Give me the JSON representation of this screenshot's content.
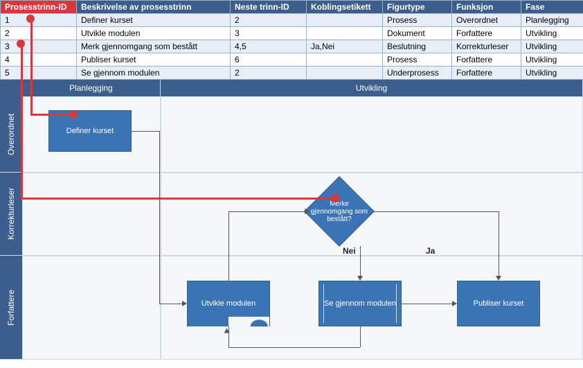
{
  "table": {
    "headers": [
      "Prosesstrinn-ID",
      "Beskrivelse av prosesstrinn",
      "Neste trinn-ID",
      "Koblingsetikett",
      "Figurtype",
      "Funksjon",
      "Fase"
    ],
    "rows": [
      {
        "id": "1",
        "desc": "Definer kurset",
        "next": "2",
        "conn": "",
        "shape": "Prosess",
        "func": "Overordnet",
        "phase": "Planlegging"
      },
      {
        "id": "2",
        "desc": "Utvikle modulen",
        "next": "3",
        "conn": "",
        "shape": "Dokument",
        "func": "Forfattere",
        "phase": "Utvikling"
      },
      {
        "id": "3",
        "desc": "Merk gjennomgang som bestått",
        "next": "4,5",
        "conn": "Ja,Nei",
        "shape": "Beslutning",
        "func": "Korrekturleser",
        "phase": "Utvikling"
      },
      {
        "id": "4",
        "desc": "Publiser kurset",
        "next": "6",
        "conn": "",
        "shape": "Prosess",
        "func": "Forfattere",
        "phase": "Utvikling"
      },
      {
        "id": "5",
        "desc": "Se gjennom modulen",
        "next": "2",
        "conn": "",
        "shape": "Underprosess",
        "func": "Forfattere",
        "phase": "Utvikling"
      }
    ]
  },
  "swimlane": {
    "phases": [
      "Planlegging",
      "Utvikling"
    ],
    "roles": [
      "Overordnet",
      "Korrekturleser",
      "Forfattere"
    ],
    "nodes": {
      "define": "Definer kurset",
      "develop": "Utvikle modulen",
      "decide": "Merke gjennomgang som bestått?",
      "review": "Se gjennom modulen",
      "publish": "Publiser kurset"
    },
    "edge_labels": {
      "no": "Nei",
      "yes": "Ja"
    }
  }
}
